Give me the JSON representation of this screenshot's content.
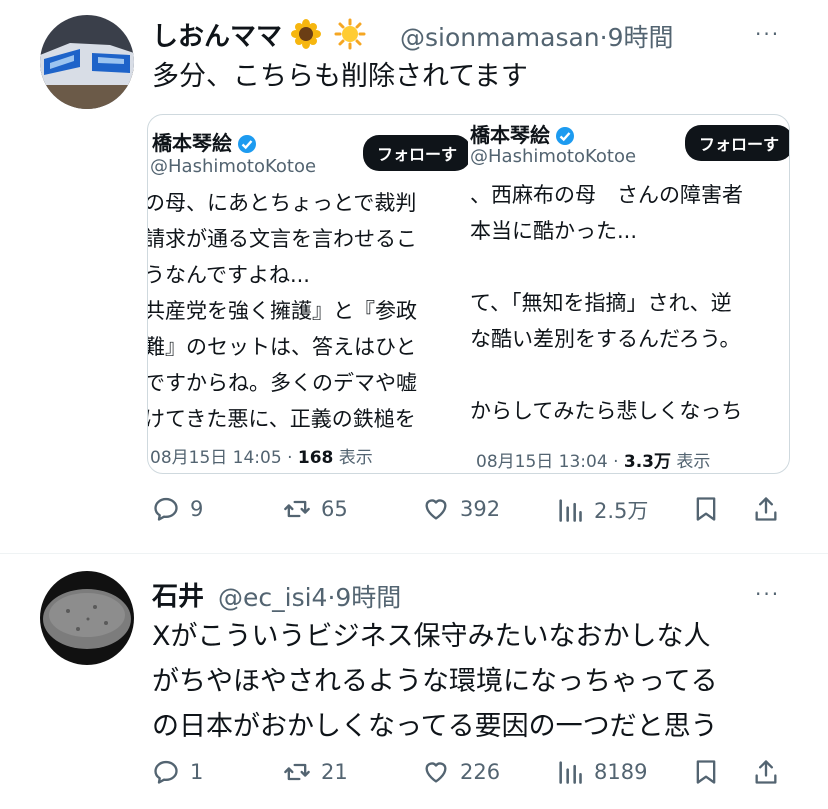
{
  "tweet1": {
    "display_name": "しおんママ",
    "emoji1": "sunflower",
    "emoji2": "sun",
    "handle": "@sionmamasan",
    "sep": "·",
    "time": "9時間",
    "text": "多分、こちらも削除されてます",
    "quote": {
      "left": {
        "name": "橋本琴絵",
        "handle": "@HashimotoKotoe",
        "follow": "フォローす",
        "lines": [
          "の母、にあとちょっとで裁判",
          "請求が通る文言を言わせるこ",
          "うなんですよね...",
          "共産党を強く擁護』と『参政",
          "難』のセットは、答えはひと",
          "ですからね。多くのデマや嘘",
          "けてきた悪に、正義の鉄槌を"
        ],
        "date": "08月15日 14:05",
        "views_sep": "·",
        "views": "168",
        "views_label": "表示"
      },
      "right": {
        "name": "橋本琴絵",
        "handle": "@HashimotoKotoe",
        "follow": "フォローす",
        "lines": [
          "、西麻布の母　さんの障害者",
          "本当に酷かった...",
          "",
          "て、「無知を指摘」され、逆",
          "な酷い差別をするんだろう。",
          "",
          "からしてみたら悲しくなっち"
        ],
        "date": "08月15日 13:04",
        "views_sep": "·",
        "views": "3.3万",
        "views_label": "表示"
      }
    },
    "actions": {
      "replies": "9",
      "retweets": "65",
      "likes": "392",
      "views": "2.5万"
    }
  },
  "tweet2": {
    "display_name": "石井",
    "handle": "@ec_isi4",
    "sep": "·",
    "time": "9時間",
    "lines": [
      "Xがこういうビジネス保守みたいなおかしな人",
      "がちやほやされるような環境になっちゃってる",
      "の日本がおかしくなってる要因の一つだと思う"
    ],
    "actions": {
      "replies": "1",
      "retweets": "21",
      "likes": "226",
      "views": "8189"
    }
  },
  "more_menu": "···",
  "colors": {
    "text": "#0f1419",
    "secondary": "#536471",
    "verified": "#1d9bf0",
    "border": "#cfd9de"
  }
}
